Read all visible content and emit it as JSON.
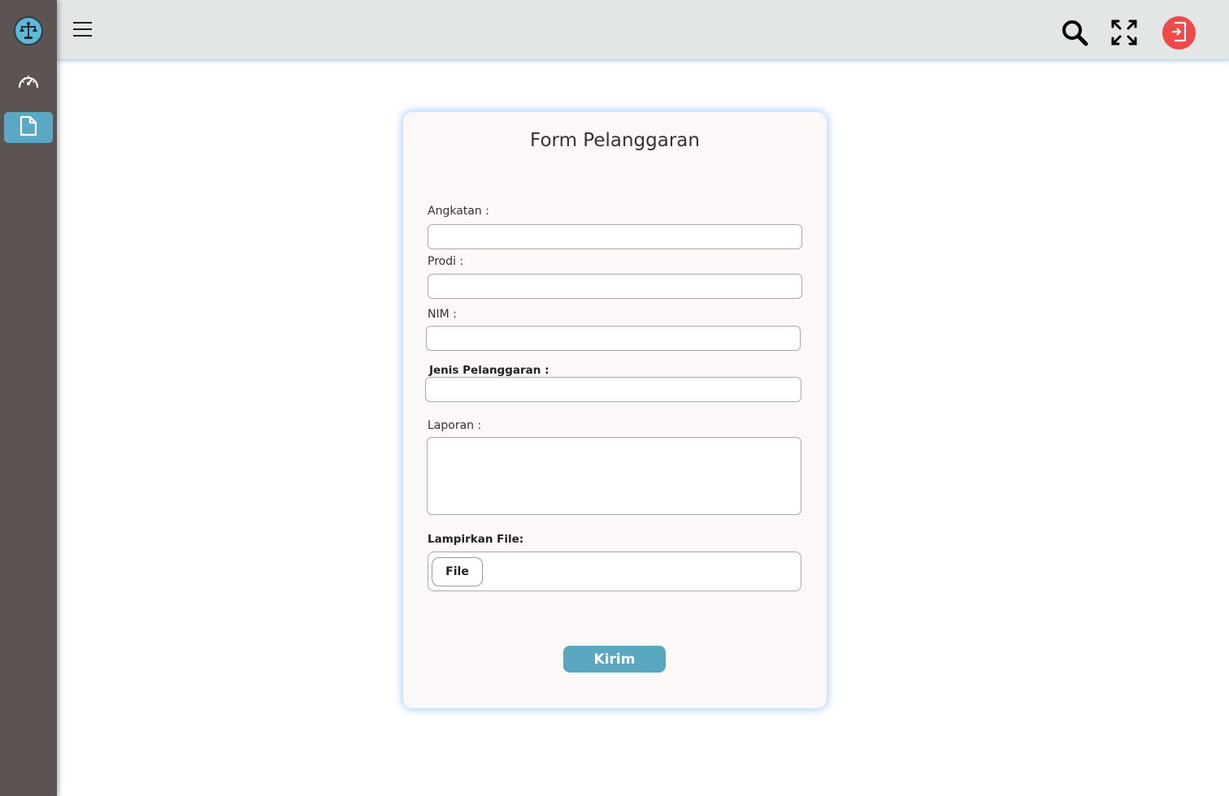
{
  "colors": {
    "sidebar_bg": "#5c5452",
    "active_nav": "#5ba8c4",
    "topbar_bg": "#e3e6e7",
    "logout_bg": "#ee4a4a",
    "card_bg": "#fcf8f7",
    "button_bg": "#5aa7c2"
  },
  "sidebar": {
    "logo_icon": "scales-of-justice-icon",
    "items": [
      {
        "icon": "speedometer-icon",
        "name": "dashboard",
        "active": false
      },
      {
        "icon": "document-icon",
        "name": "form",
        "active": true
      }
    ]
  },
  "topbar": {
    "menu_icon": "hamburger-icon",
    "actions": [
      {
        "icon": "search-icon"
      },
      {
        "icon": "fullscreen-icon"
      },
      {
        "icon": "logout-icon"
      }
    ]
  },
  "form": {
    "title": "Form Pelanggaran",
    "fields": {
      "angkatan": {
        "label": "Angkatan :",
        "value": ""
      },
      "prodi": {
        "label": "Prodi :",
        "value": ""
      },
      "nim": {
        "label": "NIM :",
        "value": ""
      },
      "jenis": {
        "label": "Jenis Pelanggaran :",
        "value": ""
      },
      "laporan": {
        "label": "Laporan :",
        "value": ""
      },
      "lampiran": {
        "label": "Lampirkan File:",
        "button_label": "File"
      }
    },
    "submit_label": "Kirim"
  }
}
